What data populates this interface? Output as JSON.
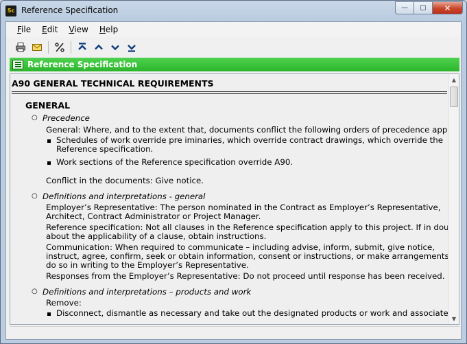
{
  "window": {
    "title": "Reference Specification",
    "app_icon_text": "Sc",
    "controls": {
      "minimize": "—",
      "maximize": "▢",
      "close": "✕"
    }
  },
  "menu": {
    "file": {
      "accel": "F",
      "rest": "ile"
    },
    "edit": {
      "accel": "E",
      "rest": "dit"
    },
    "view": {
      "accel": "V",
      "rest": "iew"
    },
    "help": {
      "accel": "H",
      "rest": "elp"
    }
  },
  "toolbar": {
    "icons": [
      "printer-icon",
      "email-icon",
      "percent-icon",
      "first-icon",
      "previous-icon",
      "next-icon",
      "last-icon"
    ]
  },
  "header": {
    "title": "Reference Specification"
  },
  "document": {
    "section_title": "A90 GENERAL TECHNICAL REQUIREMENTS",
    "heading": "GENERAL",
    "clauses": [
      {
        "title": "Precedence",
        "lines": [
          "General: Where, and to the extent that, documents conflict the following orders of precedence apply:"
        ],
        "bullets": [
          [
            "Schedules of work override pre iminaries, which override contract drawings, which override the",
            "Reference specification."
          ],
          [
            "Work sections of the Reference specification override A90."
          ]
        ],
        "after": "Conflict in the documents: Give notice."
      },
      {
        "title": "Definitions and interpretations - general",
        "lines": [
          "Employer’s Representative: The person nominated in the Contract as Employer’s Representative,",
          "Architect, Contract Administrator or Project Manager.",
          "Reference specification: Not all clauses in the Reference specification apply to this project. If in doubt",
          "about the applicability of a clause, obtain instructions.",
          "Communication: When required to communicate – including advise, inform, submit, give notice,",
          "instruct, agree, confirm, seek or obtain information, consent or instructions, or make arrangements –",
          "do so in writing to the Employer’s Representative.",
          "Responses from the Employer’s Representative: Do not proceed until response has been received."
        ]
      },
      {
        "title": "Definitions and interpretations – products and work",
        "lines": [
          "Remove:"
        ],
        "bullets": [
          [
            "Disconnect, dismantle as necessary and take out the designated products or work and associated"
          ]
        ]
      }
    ]
  }
}
